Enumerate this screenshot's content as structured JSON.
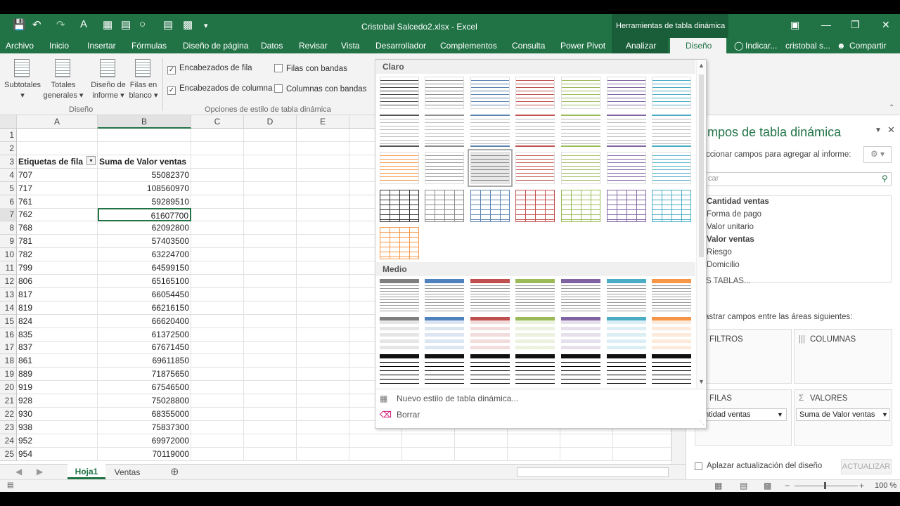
{
  "titlebar": {
    "doc_title": "Cristobal Salcedo2.xlsx - Excel",
    "context_title": "Herramientas de tabla dinámica"
  },
  "tabs": [
    "Archivo",
    "Inicio",
    "Insertar",
    "Fórmulas",
    "Diseño de página",
    "Datos",
    "Revisar",
    "Vista",
    "Desarrollador",
    "Complementos",
    "Consulta",
    "Power Pivot",
    "Analizar",
    "Diseño"
  ],
  "tell_me": "Indicar...",
  "user": "cristobal s...",
  "share": "Compartir",
  "ribbon": {
    "subtotales": "Subtotales",
    "totales_1": "Totales",
    "totales_2": "generales",
    "diseno_inf_1": "Diseño de",
    "diseno_inf_2": "informe",
    "filas_1": "Filas en",
    "filas_2": "blanco",
    "group_diseno": "Diseño",
    "chk_encab_fila": "Encabezados de fila",
    "chk_encab_col": "Encabezados de columna",
    "chk_filas_bandas": "Filas con bandas",
    "chk_cols_bandas": "Columnas con bandas",
    "group_opciones": "Opciones de estilo de tabla dinámica"
  },
  "sheet": {
    "columns": [
      "A",
      "B",
      "C",
      "D",
      "E"
    ],
    "header_a": "Etiquetas de fila",
    "header_b": "Suma de Valor ventas",
    "rows": [
      {
        "n": "1",
        "a": "",
        "b": ""
      },
      {
        "n": "2",
        "a": "",
        "b": ""
      },
      {
        "n": "3",
        "a": "",
        "b": ""
      },
      {
        "n": "4",
        "a": "707",
        "b": "55082370"
      },
      {
        "n": "5",
        "a": "717",
        "b": "108560970"
      },
      {
        "n": "6",
        "a": "761",
        "b": "59289510"
      },
      {
        "n": "7",
        "a": "762",
        "b": "61607700"
      },
      {
        "n": "8",
        "a": "768",
        "b": "62092800"
      },
      {
        "n": "9",
        "a": "781",
        "b": "57403500"
      },
      {
        "n": "10",
        "a": "782",
        "b": "63224700"
      },
      {
        "n": "11",
        "a": "799",
        "b": "64599150"
      },
      {
        "n": "12",
        "a": "806",
        "b": "65165100"
      },
      {
        "n": "13",
        "a": "817",
        "b": "66054450"
      },
      {
        "n": "14",
        "a": "819",
        "b": "66216150"
      },
      {
        "n": "15",
        "a": "824",
        "b": "66620400"
      },
      {
        "n": "16",
        "a": "835",
        "b": "61372500"
      },
      {
        "n": "17",
        "a": "837",
        "b": "67671450"
      },
      {
        "n": "18",
        "a": "861",
        "b": "69611850"
      },
      {
        "n": "19",
        "a": "889",
        "b": "71875650"
      },
      {
        "n": "20",
        "a": "919",
        "b": "67546500"
      },
      {
        "n": "21",
        "a": "928",
        "b": "75028800"
      },
      {
        "n": "22",
        "a": "930",
        "b": "68355000"
      },
      {
        "n": "23",
        "a": "938",
        "b": "75837300"
      },
      {
        "n": "24",
        "a": "952",
        "b": "69972000"
      },
      {
        "n": "25",
        "a": "954",
        "b": "70119000"
      }
    ],
    "tabs": [
      "Hoja1",
      "Ventas"
    ]
  },
  "gallery": {
    "section_claro": "Claro",
    "section_medio": "Medio",
    "new_style": "Nuevo estilo de tabla dinámica...",
    "clear": "Borrar",
    "light_colors": [
      "#7f7f7f",
      "#8c8c8c",
      "#5b84b1",
      "#c0504d",
      "#9bbb59",
      "#8064a2",
      "#4bacc6",
      "#f79646",
      "#7f7f7f",
      "#4f81bd",
      "#c0504d",
      "#9bbb59",
      "#8064a2",
      "#4bacc6",
      "#f79646"
    ],
    "medium_colors": [
      "#7f7f7f",
      "#4f81bd",
      "#c0504d",
      "#9bbb59",
      "#8064a2",
      "#4bacc6",
      "#f79646"
    ]
  },
  "pane": {
    "title": "mpos de tabla dinámica",
    "instruction": "ccionar campos para agregar al informe:",
    "search_placeholder": "car",
    "fields": [
      "Cantidad ventas",
      "Forma de pago",
      "Valor unitario",
      "Valor ventas",
      "Riesgo",
      "Domicilio"
    ],
    "more_tables": "S TABLAS...",
    "drag_text": "astrar campos entre las áreas siguientes:",
    "filtros": "FILTROS",
    "columnas": "COLUMNAS",
    "filas": "FILAS",
    "valores": "VALORES",
    "filas_value": "ntidad ventas",
    "valores_value": "Suma de Valor ventas",
    "defer": "Aplazar actualización del diseño",
    "update": "ACTUALIZAR"
  },
  "status": {
    "zoom": "100 %"
  }
}
